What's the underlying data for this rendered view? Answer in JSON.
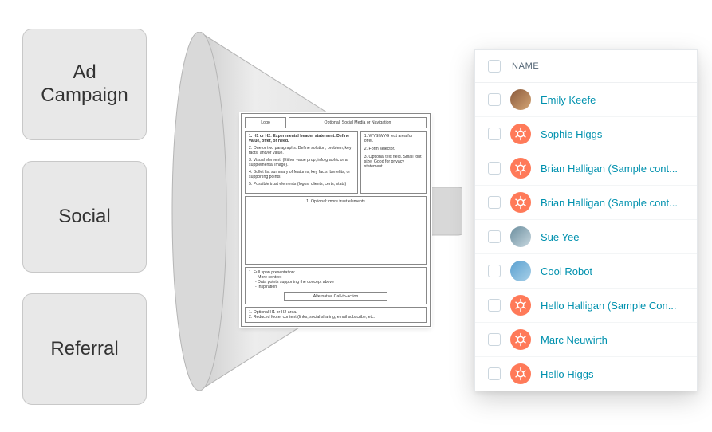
{
  "sources": [
    {
      "label": "Ad Campaign"
    },
    {
      "label": "Social"
    },
    {
      "label": "Referral"
    }
  ],
  "wireframe": {
    "logo": "Logo",
    "nav": "Optional: Social Media or Navigation",
    "main": {
      "h1": "1. H1 or H2: Experimental header statement. Define value, offer, or need.",
      "p2": "2. One or two paragraphs. Define solution, problem, key facts, and/or value.",
      "p3": "3. Visual element. (Either value prop, info graphic or a supplemental image).",
      "p4": "4. Bullet list summary of features, key facts, benefits, or supporting points.",
      "p5": "5. Possible trust elements (logos, clients, certs, stats)"
    },
    "side": {
      "s1": "1. WYSIWYG text area for offer.",
      "s2": "2. Form selector.",
      "s3": "3. Optional text field. Small font size. Good for privacy statement."
    },
    "trust": "1. Optional: more trust elements",
    "presentation": {
      "title": "1. Full span presentation:",
      "a": "- More context",
      "b": "- Data points supporting the concept above",
      "c": "- Inspiration",
      "cta": "Alternative Call-to-action"
    },
    "footer": {
      "f1": "1. Optional H1 or H2 area.",
      "f2": "2. Reduced footer content (links, social sharing, email subscribe, etc."
    }
  },
  "contacts": {
    "header": "NAME",
    "rows": [
      {
        "name": "Emily Keefe",
        "avatar": "photo1"
      },
      {
        "name": "Sophie Higgs",
        "avatar": "sprocket"
      },
      {
        "name": "Brian Halligan (Sample cont...",
        "avatar": "sprocket"
      },
      {
        "name": "Brian Halligan (Sample cont...",
        "avatar": "sprocket"
      },
      {
        "name": "Sue Yee",
        "avatar": "photo2"
      },
      {
        "name": "Cool Robot",
        "avatar": "photo3"
      },
      {
        "name": "Hello Halligan (Sample Con...",
        "avatar": "sprocket"
      },
      {
        "name": "Marc Neuwirth",
        "avatar": "sprocket"
      },
      {
        "name": "Hello Higgs",
        "avatar": "sprocket"
      }
    ]
  }
}
